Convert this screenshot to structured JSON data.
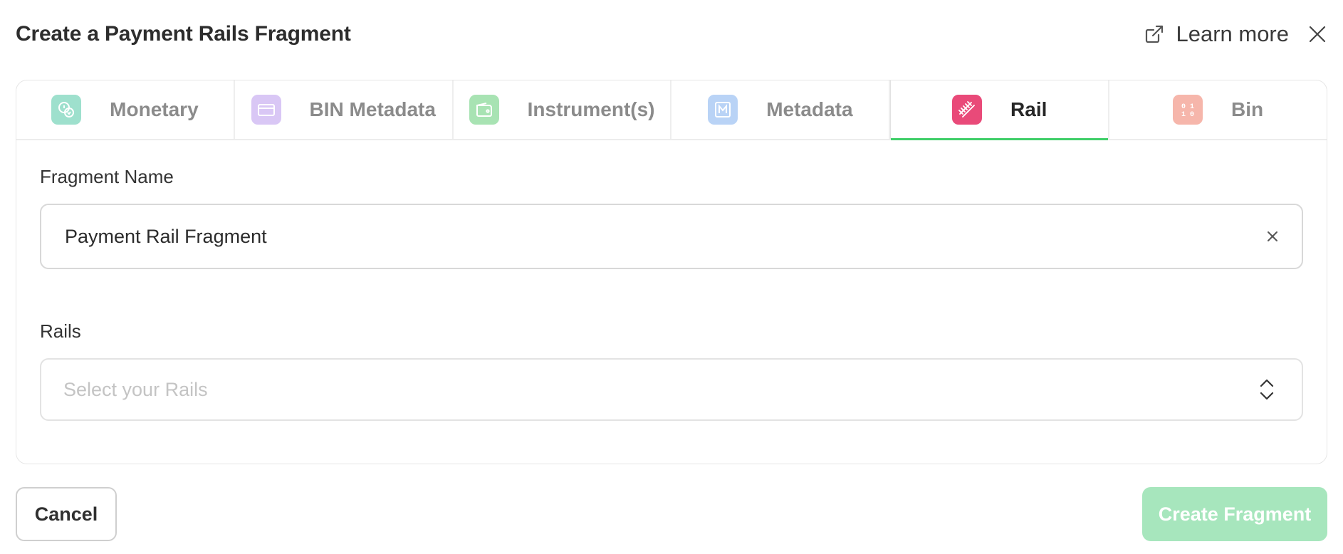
{
  "dialog": {
    "title": "Create a Payment Rails Fragment",
    "learn_more": "Learn more",
    "icons": {
      "learn_more": "external-link-icon",
      "close": "close-icon"
    }
  },
  "tabs": [
    {
      "label": "Monetary",
      "icon": "monetary-icon",
      "color": "#9ee0cd",
      "active": false
    },
    {
      "label": "BIN Metadata",
      "icon": "card-icon",
      "color": "#d9c7f5",
      "active": false
    },
    {
      "label": "Instrument(s)",
      "icon": "wallet-icon",
      "color": "#a8e3b3",
      "active": false
    },
    {
      "label": "Metadata",
      "icon": "metadata-icon",
      "color": "#b9d3f6",
      "active": false
    },
    {
      "label": "Rail",
      "icon": "rail-icon",
      "color": "#e94a79",
      "active": true
    },
    {
      "label": "Bin",
      "icon": "binary-icon",
      "color": "#f6b6ab",
      "active": false
    }
  ],
  "form": {
    "fragment_name": {
      "label": "Fragment Name",
      "value": "Payment Rail Fragment",
      "clear_icon": "clear-icon"
    },
    "rails": {
      "label": "Rails",
      "placeholder": "Select your Rails",
      "icon": "chevron-up-down-icon"
    }
  },
  "footer": {
    "cancel_label": "Cancel",
    "create_label": "Create Fragment"
  },
  "colors": {
    "accent": "#3fce68",
    "create_button_disabled": "#a7e6bd",
    "active_tab_icon": "#e94a79"
  }
}
